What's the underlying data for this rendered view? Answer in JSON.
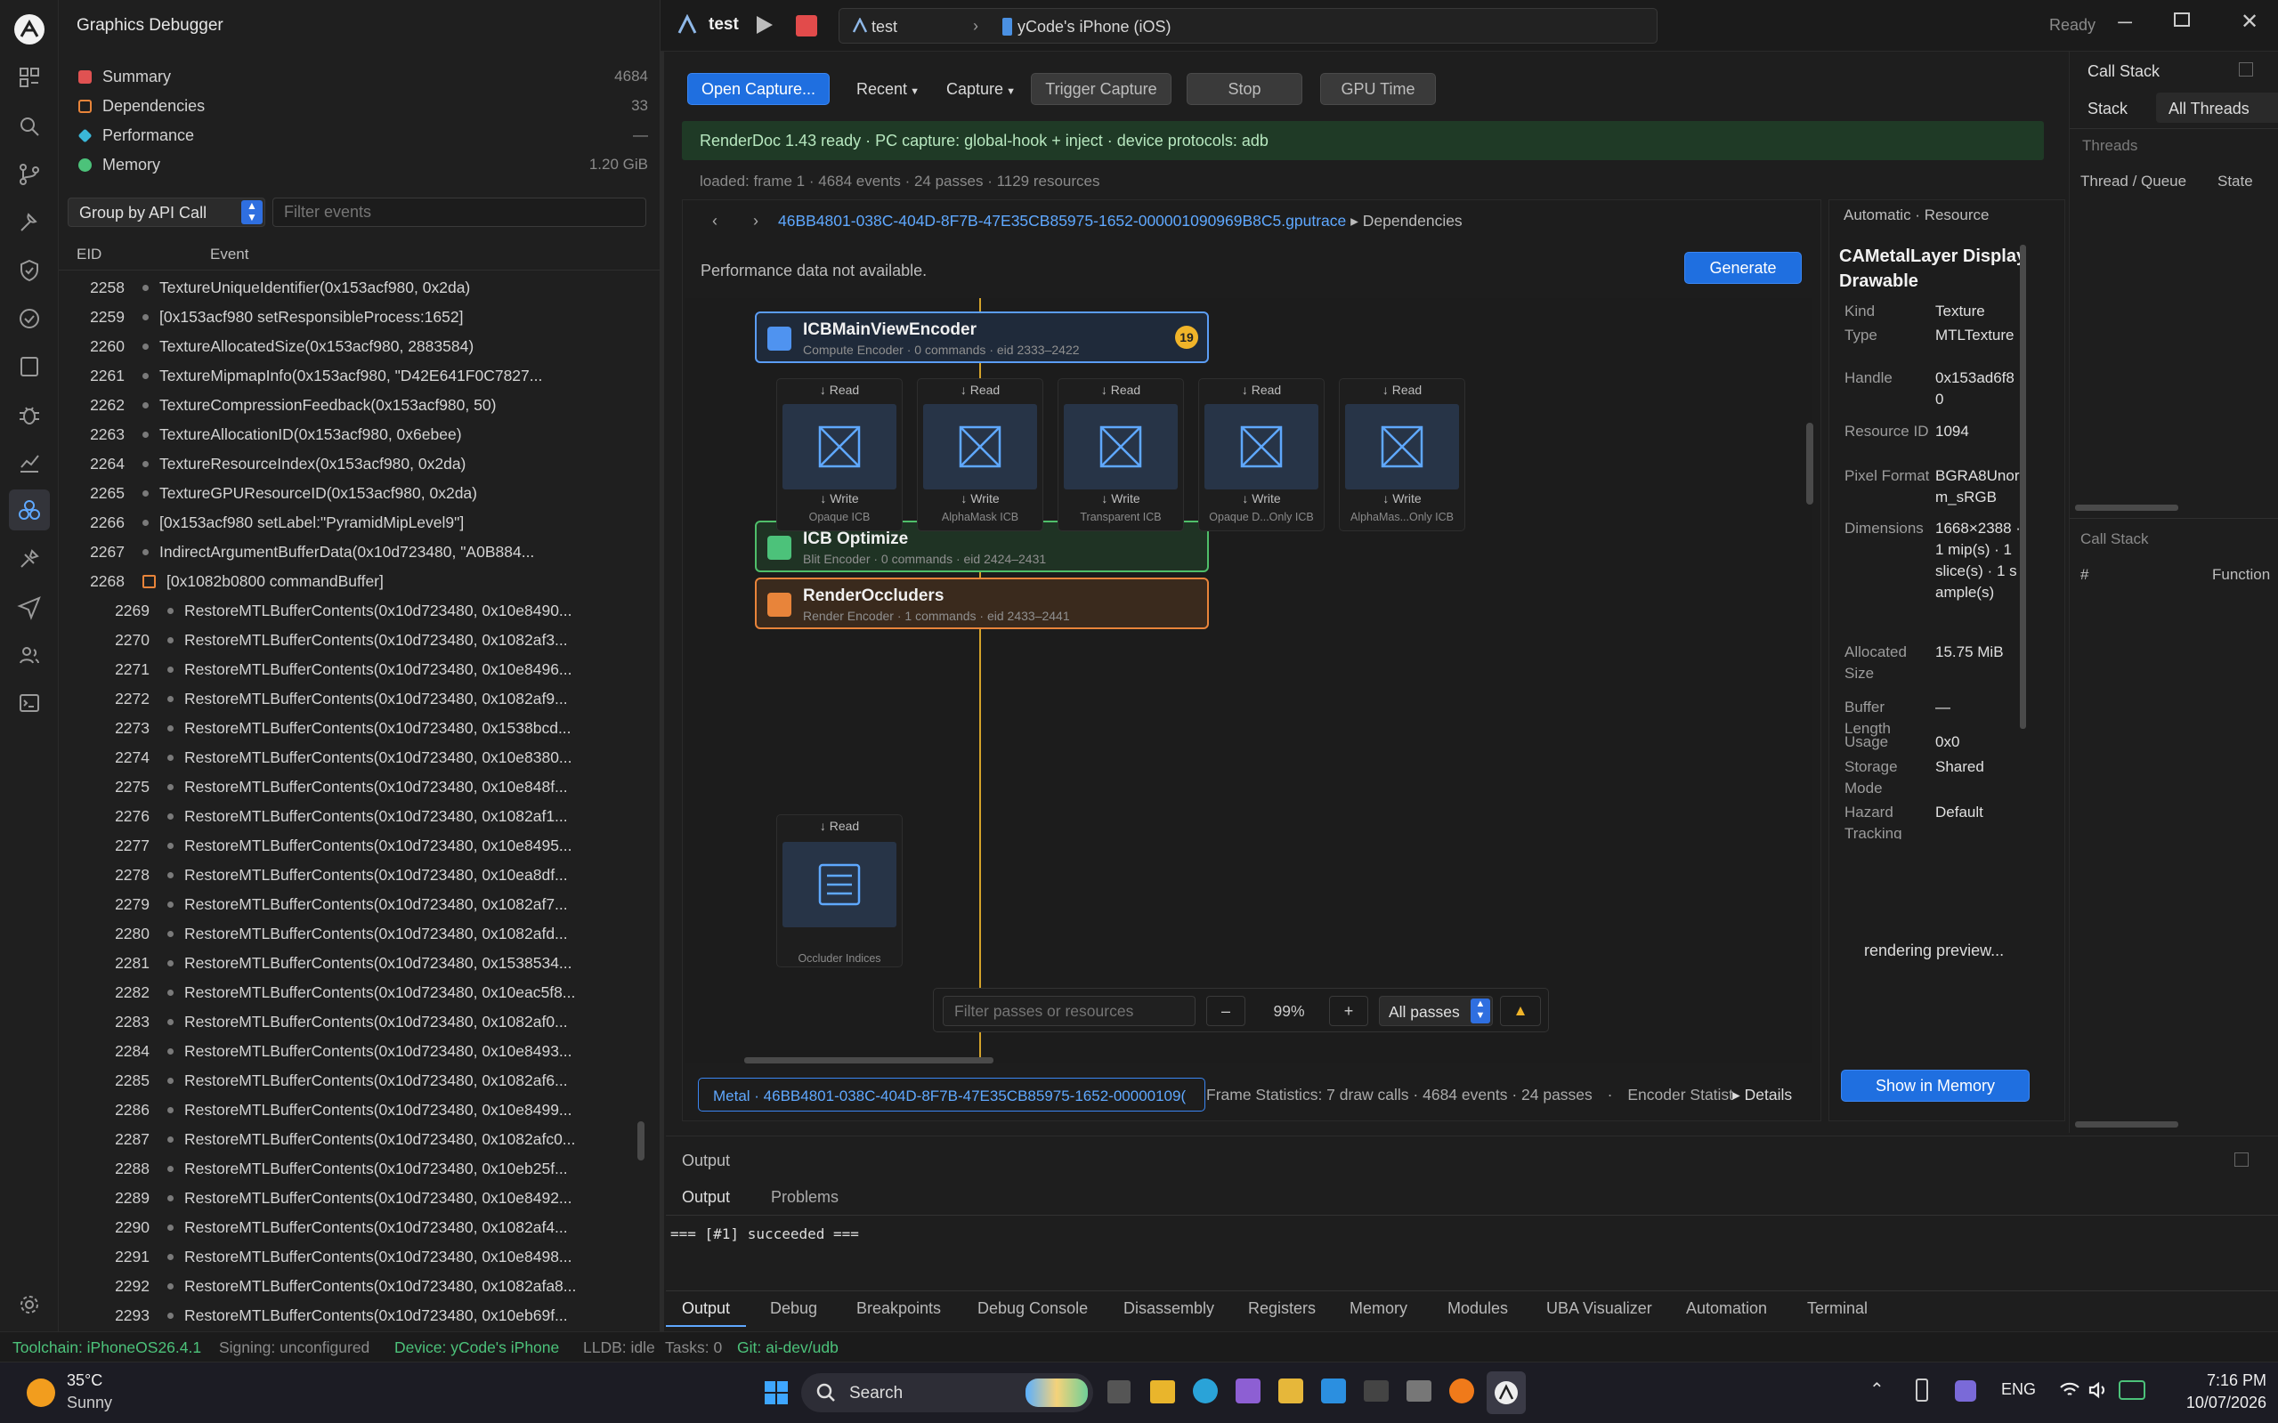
{
  "app": {
    "title": "Graphics Debugger"
  },
  "left": {
    "nav": [
      {
        "label": "Summary",
        "count": "4684",
        "color": "#e05252",
        "kind": "fill"
      },
      {
        "label": "Dependencies",
        "count": "33",
        "color": "#e8843a",
        "kind": "outline"
      },
      {
        "label": "Performance",
        "count": "—",
        "color": "#3ab7d8",
        "kind": "diamond"
      },
      {
        "label": "Memory",
        "count": "1.20 GiB",
        "color": "#4cc27a",
        "kind": "circle"
      }
    ],
    "group_select": "Group by API Call",
    "filter_placeholder": "Filter events",
    "col_eid": "EID",
    "col_event": "Event",
    "events": [
      {
        "eid": "2258",
        "text": "TextureUniqueIdentifier(0x153acf980, 0x2da)",
        "child": false
      },
      {
        "eid": "2259",
        "text": "[0x153acf980 setResponsibleProcess:1652]",
        "child": false
      },
      {
        "eid": "2260",
        "text": "TextureAllocatedSize(0x153acf980, 2883584)",
        "child": false
      },
      {
        "eid": "2261",
        "text": "TextureMipmapInfo(0x153acf980, \"D42E641F0C7827...",
        "child": false
      },
      {
        "eid": "2262",
        "text": "TextureCompressionFeedback(0x153acf980, 50)",
        "child": false
      },
      {
        "eid": "2263",
        "text": "TextureAllocationID(0x153acf980, 0x6ebee)",
        "child": false
      },
      {
        "eid": "2264",
        "text": "TextureResourceIndex(0x153acf980, 0x2da)",
        "child": false
      },
      {
        "eid": "2265",
        "text": "TextureGPUResourceID(0x153acf980, 0x2da)",
        "child": false
      },
      {
        "eid": "2266",
        "text": "[0x153acf980 setLabel:\"PyramidMipLevel9\"]",
        "child": false
      },
      {
        "eid": "2267",
        "text": "IndirectArgumentBufferData(0x10d723480, \"A0B884...",
        "child": false
      },
      {
        "eid": "2268",
        "text": "[0x1082b0800 commandBuffer]",
        "child": false,
        "box": true
      },
      {
        "eid": "2269",
        "text": "RestoreMTLBufferContents(0x10d723480, 0x10e8490...",
        "child": true
      },
      {
        "eid": "2270",
        "text": "RestoreMTLBufferContents(0x10d723480, 0x1082af3...",
        "child": true
      },
      {
        "eid": "2271",
        "text": "RestoreMTLBufferContents(0x10d723480, 0x10e8496...",
        "child": true
      },
      {
        "eid": "2272",
        "text": "RestoreMTLBufferContents(0x10d723480, 0x1082af9...",
        "child": true
      },
      {
        "eid": "2273",
        "text": "RestoreMTLBufferContents(0x10d723480, 0x1538bcd...",
        "child": true
      },
      {
        "eid": "2274",
        "text": "RestoreMTLBufferContents(0x10d723480, 0x10e8380...",
        "child": true
      },
      {
        "eid": "2275",
        "text": "RestoreMTLBufferContents(0x10d723480, 0x10e848f...",
        "child": true
      },
      {
        "eid": "2276",
        "text": "RestoreMTLBufferContents(0x10d723480, 0x1082af1...",
        "child": true
      },
      {
        "eid": "2277",
        "text": "RestoreMTLBufferContents(0x10d723480, 0x10e8495...",
        "child": true
      },
      {
        "eid": "2278",
        "text": "RestoreMTLBufferContents(0x10d723480, 0x10ea8df...",
        "child": true
      },
      {
        "eid": "2279",
        "text": "RestoreMTLBufferContents(0x10d723480, 0x1082af7...",
        "child": true
      },
      {
        "eid": "2280",
        "text": "RestoreMTLBufferContents(0x10d723480, 0x1082afd...",
        "child": true
      },
      {
        "eid": "2281",
        "text": "RestoreMTLBufferContents(0x10d723480, 0x1538534...",
        "child": true
      },
      {
        "eid": "2282",
        "text": "RestoreMTLBufferContents(0x10d723480, 0x10eac5f8...",
        "child": true
      },
      {
        "eid": "2283",
        "text": "RestoreMTLBufferContents(0x10d723480, 0x1082af0...",
        "child": true
      },
      {
        "eid": "2284",
        "text": "RestoreMTLBufferContents(0x10d723480, 0x10e8493...",
        "child": true
      },
      {
        "eid": "2285",
        "text": "RestoreMTLBufferContents(0x10d723480, 0x1082af6...",
        "child": true
      },
      {
        "eid": "2286",
        "text": "RestoreMTLBufferContents(0x10d723480, 0x10e8499...",
        "child": true
      },
      {
        "eid": "2287",
        "text": "RestoreMTLBufferContents(0x10d723480, 0x1082afc0...",
        "child": true
      },
      {
        "eid": "2288",
        "text": "RestoreMTLBufferContents(0x10d723480, 0x10eb25f...",
        "child": true
      },
      {
        "eid": "2289",
        "text": "RestoreMTLBufferContents(0x10d723480, 0x10e8492...",
        "child": true
      },
      {
        "eid": "2290",
        "text": "RestoreMTLBufferContents(0x10d723480, 0x1082af4...",
        "child": true
      },
      {
        "eid": "2291",
        "text": "RestoreMTLBufferContents(0x10d723480, 0x10e8498...",
        "child": true
      },
      {
        "eid": "2292",
        "text": "RestoreMTLBufferContents(0x10d723480, 0x1082afa8...",
        "child": true
      },
      {
        "eid": "2293",
        "text": "RestoreMTLBufferContents(0x10d723480, 0x10eb69f...",
        "child": true
      }
    ]
  },
  "topbar": {
    "project": "test",
    "crumb_project": "test",
    "crumb_device": "yCode's iPhone (iOS)",
    "status": "Ready"
  },
  "toolbar": {
    "open": "Open Capture...",
    "recent": "Recent",
    "capture": "Capture",
    "trigger": "Trigger Capture",
    "stop": "Stop",
    "gpu_time": "GPU Time"
  },
  "banner": "RenderDoc 1.43 ready · PC capture: global-hook + inject · device protocols: adb",
  "loaded": "loaded: frame 1 · 4684 events · 24 passes · 1129 resources",
  "breadcrumb": {
    "file": "46BB4801-038C-404D-8F7B-47E35CB85975-1652-000001090969B8C5.gputrace",
    "sep": "▸",
    "section": "Dependencies"
  },
  "perf": {
    "message": "Performance data not available.",
    "generate": "Generate"
  },
  "graph": {
    "encoders": [
      {
        "title": "ICBMainViewEncoder",
        "sub": "Compute Encoder · 0 commands · eid 2333–2422",
        "badge": "19"
      },
      {
        "title": "ICB Optimize",
        "sub": "Blit Encoder · 0 commands · eid 2424–2431"
      },
      {
        "title": "RenderOccluders",
        "sub": "Render Encoder · 1 commands · eid 2433–2441"
      }
    ],
    "read": "↓ Read",
    "write": "↓ Write",
    "icb_resources": [
      "Opaque ICB",
      "AlphaMask ICB",
      "Transparent ICB",
      "Opaque D...Only ICB",
      "AlphaMas...Only ICB"
    ],
    "occluder_resource": "Occluder Indices",
    "filter_placeholder": "Filter passes or resources",
    "zoom_out": "–",
    "zoom": "99%",
    "zoom_in": "+",
    "passes_select": "All passes",
    "warn": "▲"
  },
  "statusline": {
    "metal": "Metal · 46BB4801-038C-404D-8F7B-47E35CB85975-1652-00000109(",
    "stats": "Frame Statistics: 7 draw calls · 4684 events · 24 passes",
    "sep": "·",
    "encoder": "Encoder Statist",
    "details": "▸ Details"
  },
  "resource_panel": {
    "header": "Automatic · Resource",
    "name": "CAMetalLayer Display Drawable",
    "fields": [
      {
        "k": "Kind",
        "v": "Texture"
      },
      {
        "k": "Type",
        "v": "MTLTexture"
      },
      {
        "k": "Handle",
        "v": "0x153ad6f80"
      },
      {
        "k": "Resource ID",
        "v": "1094"
      },
      {
        "k": "Pixel Format",
        "v": "BGRA8Unorm_sRGB"
      },
      {
        "k": "Dimensions",
        "v": "1668×2388 · 1 mip(s) · 1 slice(s) · 1 sample(s)"
      },
      {
        "k": "Allocated Size",
        "v": "15.75 MiB"
      },
      {
        "k": "Buffer Length",
        "v": "—"
      },
      {
        "k": "Usage",
        "v": "0x0"
      },
      {
        "k": "Storage Mode",
        "v": "Shared"
      },
      {
        "k": "Hazard Tracking",
        "v": "Default"
      }
    ],
    "preview": "rendering preview...",
    "show_memory": "Show in Memory"
  },
  "callstack": {
    "title": "Call Stack",
    "tabs": [
      "Stack",
      "All Threads"
    ],
    "threads": "Threads",
    "col_thread": "Thread / Queue",
    "col_state": "State",
    "title2": "Call Stack",
    "col_num": "#",
    "col_fn": "Function"
  },
  "output": {
    "title": "Output",
    "tabs": [
      "Output",
      "Problems"
    ],
    "line": "=== [#1] succeeded ==="
  },
  "bottom_tabs": [
    "Output",
    "Debug",
    "Breakpoints",
    "Debug Console",
    "Disassembly",
    "Registers",
    "Memory",
    "Modules",
    "UBA Visualizer",
    "Automation",
    "Terminal"
  ],
  "statusbar": {
    "toolchain": "Toolchain: iPhoneOS26.4.1",
    "signing": "Signing: unconfigured",
    "device": "Device: yCode's iPhone",
    "lldb": "LLDB: idle",
    "tasks": "Tasks: 0",
    "git": "Git: ai-dev/udb"
  },
  "taskbar": {
    "temp": "35°C",
    "weather": "Sunny",
    "search": "Search",
    "lang": "ENG",
    "time": "7:16 PM",
    "date": "10/07/2026"
  }
}
